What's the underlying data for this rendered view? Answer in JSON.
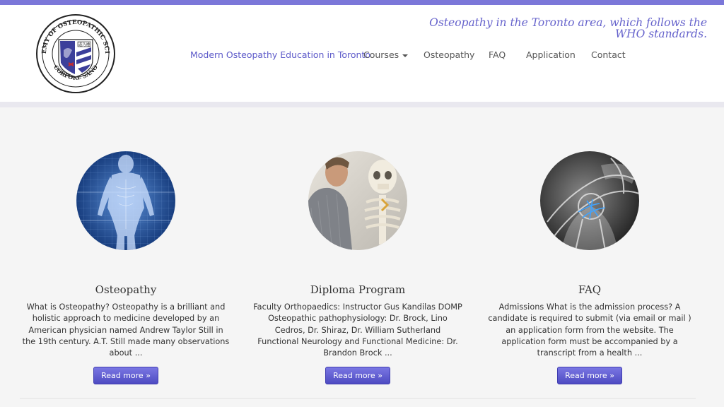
{
  "header": {
    "tagline": "Osteopathy in the Toronto area, which follows the WHO standards.",
    "logo": {
      "ring_text_top": "ACADEMY OF OSTEOPATHIC SCIENCE",
      "ring_text_bottom": "CORPORE SANO",
      "seal_text": "道乃禮"
    }
  },
  "nav": {
    "items": [
      {
        "label": "Modern Osteopathy Education in Toronto",
        "active": true
      },
      {
        "label": "Courses",
        "dropdown": true
      },
      {
        "label": "Osteopathy"
      },
      {
        "label": "FAQ"
      },
      {
        "label": "Application"
      },
      {
        "label": "Contact"
      }
    ]
  },
  "features": [
    {
      "title": "Osteopathy",
      "text": "What is Osteopathy? Osteopathy is a brilliant and holistic approach to medicine developed by an American physician named Andrew Taylor Still in the 19th century.  A.T. Still made many observations about ...",
      "button": "Read more »",
      "image_icon": "anatomy-body-icon"
    },
    {
      "title": "Diploma Program",
      "text": "Faculty Orthopaedics: Instructor Gus Kandilas DOMP Osteopathic pathophysiology: Dr. Brock, Lino Cedros, Dr. Shiraz, Dr. William Sutherland Functional Neurology and Functional Medicine: Dr. Brandon Brock ...",
      "button": "Read more »",
      "image_icon": "skeleton-model-icon"
    },
    {
      "title": "FAQ",
      "text": "Admissions What is the admission process? A candidate is required to submit (via email or mail ) an application form from the website. The application form must be accompanied by a transcript from a health ...",
      "button": "Read more »",
      "image_icon": "xray-shoulder-icon"
    }
  ],
  "colors": {
    "accent": "#6663cc",
    "button": "#5653c6",
    "top_stripe": "#7b77d9"
  }
}
